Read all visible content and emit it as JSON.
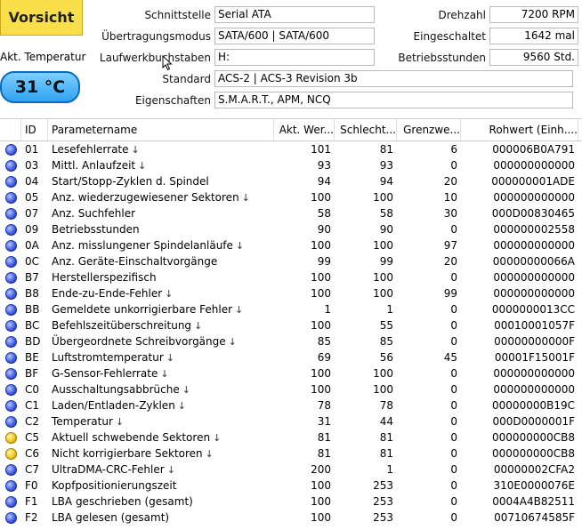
{
  "status_text": "Vorsicht",
  "temperature": {
    "label": "Akt. Temperatur",
    "value": "31 °C"
  },
  "info_left": [
    {
      "label": "Schnittstelle",
      "value": "Serial ATA"
    },
    {
      "label": "Übertragungsmodus",
      "value": "SATA/600 | SATA/600"
    },
    {
      "label": "Laufwerkbuchstaben",
      "value": "H:"
    },
    {
      "label": "Standard",
      "value": "ACS-2 | ACS-3 Revision 3b"
    },
    {
      "label": "Eigenschaften",
      "value": "S.M.A.R.T., APM, NCQ"
    }
  ],
  "info_right": [
    {
      "label": "Drehzahl",
      "value": "7200 RPM"
    },
    {
      "label": "Eingeschaltet",
      "value": "1642 mal"
    },
    {
      "label": "Betriebsstunden",
      "value": "9560 Std."
    }
  ],
  "table": {
    "headers": [
      "ID",
      "Parametername",
      "Akt. Wer...",
      "Schlecht...",
      "Grenzwe...",
      "Rohwert (Einh...."
    ],
    "rows": [
      {
        "status": "blue",
        "id": "01",
        "name": "Lesefehlerrate",
        "arrow": true,
        "cur": "101",
        "worst": "81",
        "thr": "6",
        "raw": "000006B0A791"
      },
      {
        "status": "blue",
        "id": "03",
        "name": "Mittl. Anlaufzeit",
        "arrow": true,
        "cur": "93",
        "worst": "93",
        "thr": "0",
        "raw": "000000000000"
      },
      {
        "status": "blue",
        "id": "04",
        "name": "Start/Stopp-Zyklen d. Spindel",
        "arrow": false,
        "cur": "94",
        "worst": "94",
        "thr": "20",
        "raw": "000000001ADE"
      },
      {
        "status": "blue",
        "id": "05",
        "name": "Anz. wiederzugewiesener Sektoren",
        "arrow": true,
        "cur": "100",
        "worst": "100",
        "thr": "10",
        "raw": "000000000000"
      },
      {
        "status": "blue",
        "id": "07",
        "name": "Anz. Suchfehler",
        "arrow": false,
        "cur": "58",
        "worst": "58",
        "thr": "30",
        "raw": "000D00830465"
      },
      {
        "status": "blue",
        "id": "09",
        "name": "Betriebsstunden",
        "arrow": false,
        "cur": "90",
        "worst": "90",
        "thr": "0",
        "raw": "000000002558"
      },
      {
        "status": "blue",
        "id": "0A",
        "name": "Anz. misslungener Spindelanläufe",
        "arrow": true,
        "cur": "100",
        "worst": "100",
        "thr": "97",
        "raw": "000000000000"
      },
      {
        "status": "blue",
        "id": "0C",
        "name": "Anz. Geräte-Einschaltvorgänge",
        "arrow": false,
        "cur": "99",
        "worst": "99",
        "thr": "20",
        "raw": "00000000066A"
      },
      {
        "status": "blue",
        "id": "B7",
        "name": "Herstellerspezifisch",
        "arrow": false,
        "cur": "100",
        "worst": "100",
        "thr": "0",
        "raw": "000000000000"
      },
      {
        "status": "blue",
        "id": "B8",
        "name": "Ende-zu-Ende-Fehler",
        "arrow": true,
        "cur": "100",
        "worst": "100",
        "thr": "99",
        "raw": "000000000000"
      },
      {
        "status": "blue",
        "id": "BB",
        "name": "Gemeldete unkorrigierbare Fehler",
        "arrow": true,
        "cur": "1",
        "worst": "1",
        "thr": "0",
        "raw": "0000000013CC"
      },
      {
        "status": "blue",
        "id": "BC",
        "name": "Befehlszeitüberschreitung",
        "arrow": true,
        "cur": "100",
        "worst": "55",
        "thr": "0",
        "raw": "00010001057F"
      },
      {
        "status": "blue",
        "id": "BD",
        "name": "Übergeordnete Schreibvorgänge",
        "arrow": true,
        "cur": "85",
        "worst": "85",
        "thr": "0",
        "raw": "00000000000F"
      },
      {
        "status": "blue",
        "id": "BE",
        "name": "Luftstromtemperatur",
        "arrow": true,
        "cur": "69",
        "worst": "56",
        "thr": "45",
        "raw": "00001F15001F"
      },
      {
        "status": "blue",
        "id": "BF",
        "name": "G-Sensor-Fehlerrate",
        "arrow": true,
        "cur": "100",
        "worst": "100",
        "thr": "0",
        "raw": "000000000000"
      },
      {
        "status": "blue",
        "id": "C0",
        "name": "Ausschaltungsabbrüche",
        "arrow": true,
        "cur": "100",
        "worst": "100",
        "thr": "0",
        "raw": "000000000000"
      },
      {
        "status": "blue",
        "id": "C1",
        "name": "Laden/Entladen-Zyklen",
        "arrow": true,
        "cur": "78",
        "worst": "78",
        "thr": "0",
        "raw": "00000000B19C"
      },
      {
        "status": "blue",
        "id": "C2",
        "name": "Temperatur",
        "arrow": true,
        "cur": "31",
        "worst": "44",
        "thr": "0",
        "raw": "000D0000001F"
      },
      {
        "status": "yellow",
        "id": "C5",
        "name": "Aktuell schwebende Sektoren",
        "arrow": true,
        "cur": "81",
        "worst": "81",
        "thr": "0",
        "raw": "000000000CB8"
      },
      {
        "status": "yellow",
        "id": "C6",
        "name": "Nicht korrigierbare Sektoren",
        "arrow": true,
        "cur": "81",
        "worst": "81",
        "thr": "0",
        "raw": "000000000CB8"
      },
      {
        "status": "blue",
        "id": "C7",
        "name": "UltraDMA-CRC-Fehler",
        "arrow": true,
        "cur": "200",
        "worst": "1",
        "thr": "0",
        "raw": "00000002CFA2"
      },
      {
        "status": "blue",
        "id": "F0",
        "name": "Kopfpositionierungszeit",
        "arrow": false,
        "cur": "100",
        "worst": "253",
        "thr": "0",
        "raw": "310E0000076E"
      },
      {
        "status": "blue",
        "id": "F1",
        "name": "LBA geschrieben (gesamt)",
        "arrow": false,
        "cur": "100",
        "worst": "253",
        "thr": "0",
        "raw": "0004A4B82511"
      },
      {
        "status": "blue",
        "id": "F2",
        "name": "LBA gelesen (gesamt)",
        "arrow": false,
        "cur": "100",
        "worst": "253",
        "thr": "0",
        "raw": "00710674585F"
      }
    ]
  },
  "colors": {
    "warning": "#f9df4a",
    "temp_blue": "#2fa3f1",
    "good": "#3b57e0",
    "caution": "#f1c40f"
  }
}
